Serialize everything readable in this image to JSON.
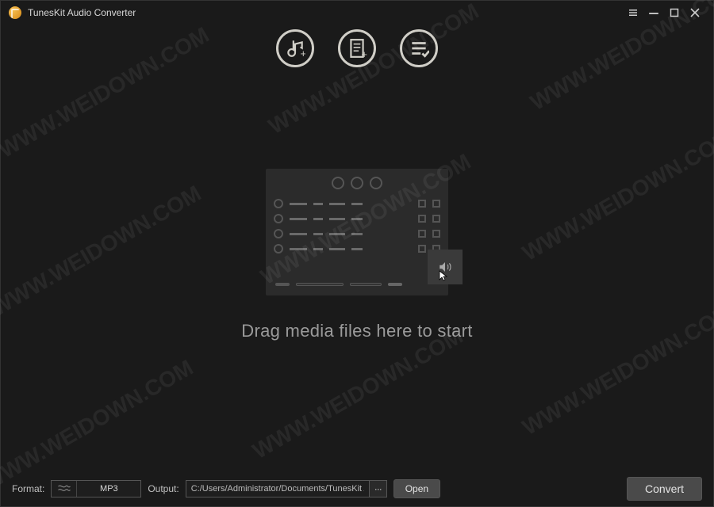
{
  "titlebar": {
    "title": "TunesKit Audio Converter"
  },
  "toolbar": {
    "add_music_title": "Add music",
    "add_file_title": "Add file",
    "settings_title": "List settings"
  },
  "main": {
    "drop_text": "Drag media files here to start"
  },
  "footer": {
    "format_label": "Format:",
    "format_value": "MP3",
    "output_label": "Output:",
    "output_path": "C:/Users/Administrator/Documents/TunesKit A",
    "browse_label": "···",
    "open_label": "Open",
    "convert_label": "Convert"
  },
  "watermark": "WWW.WEIDOWN.COM"
}
